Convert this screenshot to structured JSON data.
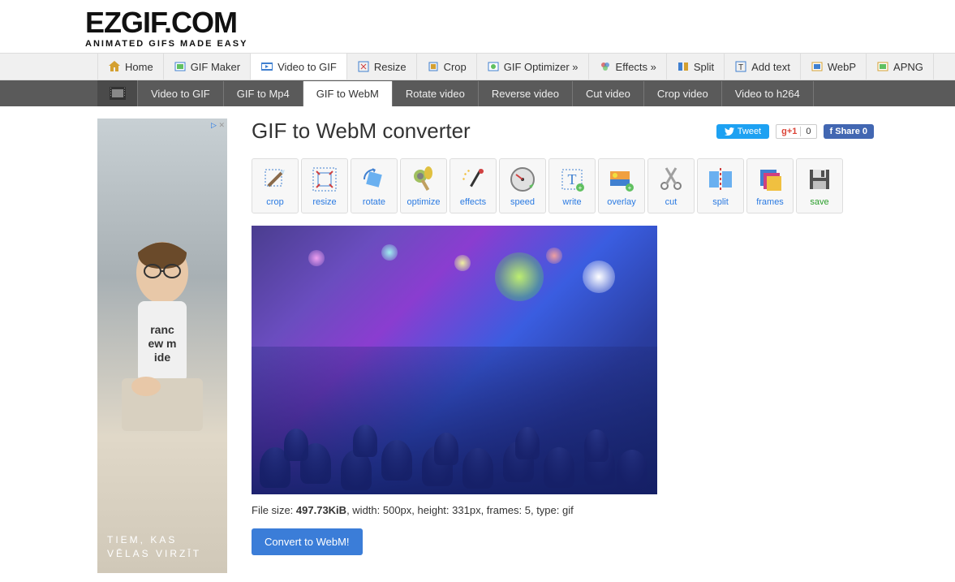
{
  "logo": "EZGIF.COM",
  "tagline": "ANIMATED GIFS MADE EASY",
  "main_nav": [
    {
      "label": "Home"
    },
    {
      "label": "GIF Maker"
    },
    {
      "label": "Video to GIF"
    },
    {
      "label": "Resize"
    },
    {
      "label": "Crop"
    },
    {
      "label": "GIF Optimizer »"
    },
    {
      "label": "Effects »"
    },
    {
      "label": "Split"
    },
    {
      "label": "Add text"
    },
    {
      "label": "WebP"
    },
    {
      "label": "APNG"
    }
  ],
  "sub_nav": [
    {
      "label": "Video to GIF"
    },
    {
      "label": "GIF to Mp4"
    },
    {
      "label": "GIF to WebM"
    },
    {
      "label": "Rotate video"
    },
    {
      "label": "Reverse video"
    },
    {
      "label": "Cut video"
    },
    {
      "label": "Crop video"
    },
    {
      "label": "Video to h264"
    }
  ],
  "page_title": "GIF to WebM converter",
  "social": {
    "tweet": "Tweet",
    "gplus_count": "0",
    "fb_share": "Share 0"
  },
  "tools": [
    {
      "label": "crop"
    },
    {
      "label": "resize"
    },
    {
      "label": "rotate"
    },
    {
      "label": "optimize"
    },
    {
      "label": "effects"
    },
    {
      "label": "speed"
    },
    {
      "label": "write"
    },
    {
      "label": "overlay"
    },
    {
      "label": "cut"
    },
    {
      "label": "split"
    },
    {
      "label": "frames"
    },
    {
      "label": "save"
    }
  ],
  "file_info": {
    "prefix": "File size: ",
    "size": "497.73KiB",
    "rest": ", width: 500px, height: 331px, frames: 5, type: gif"
  },
  "convert_button": "Convert to WebM!",
  "ad": {
    "text_line1": "TIEM, KAS",
    "text_line2": "VĒLAS VIRZĪT"
  }
}
